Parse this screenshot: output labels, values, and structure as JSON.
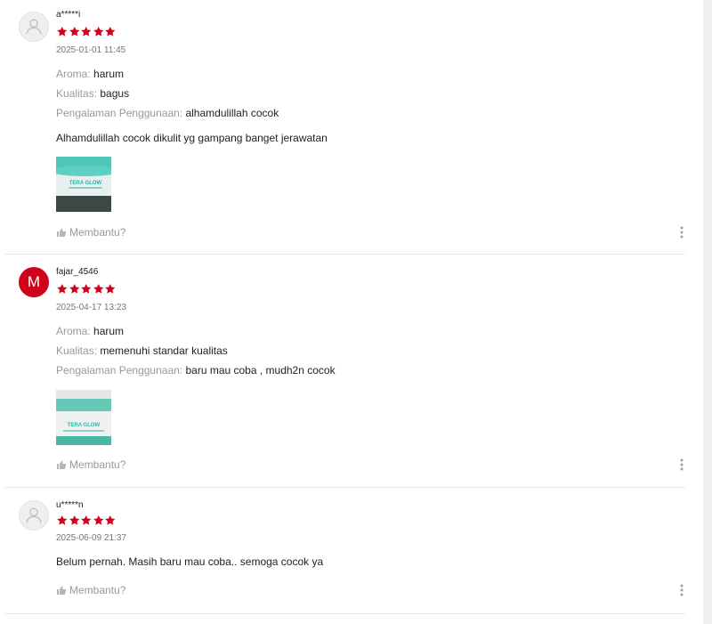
{
  "reviews": [
    {
      "username": "a*****i",
      "avatar_type": "placeholder",
      "rating": 5,
      "date": "2025-01-01 11:45",
      "attributes": [
        {
          "label": "Aroma:",
          "value": "harum"
        },
        {
          "label": "Kualitas:",
          "value": "bagus"
        },
        {
          "label": "Pengalaman Penggunaan:",
          "value": "alhamdulillah cocok"
        }
      ],
      "comment": "Alhamdulillah cocok dikulit yg gampang banget jerawatan",
      "photo_brand": "TERA GLOW",
      "helpful_label": "Membantu?"
    },
    {
      "username": "fajar_4546",
      "avatar_type": "letter",
      "avatar_letter": "M",
      "rating": 5,
      "date": "2025-04-17 13:23",
      "attributes": [
        {
          "label": "Aroma:",
          "value": "harum"
        },
        {
          "label": "Kualitas:",
          "value": "memenuhi standar kualitas"
        },
        {
          "label": "Pengalaman Penggunaan:",
          "value": "baru mau coba , mudh2n cocok"
        }
      ],
      "photo_brand": "TERA GLOW",
      "helpful_label": "Membantu?"
    },
    {
      "username": "u*****n",
      "avatar_type": "placeholder",
      "rating": 5,
      "date": "2025-06-09 21:37",
      "comment": "Belum pernah. Masih baru mau coba.. semoga cocok ya",
      "helpful_label": "Membantu?"
    }
  ],
  "colors": {
    "star": "#d0011b",
    "avatar_letter_bg": "#d0011b",
    "label": "#999999",
    "divider": "#e8e8e8"
  },
  "icons": [
    "user-placeholder-icon",
    "star-icon",
    "thumbs-up-icon",
    "kebab-menu-icon"
  ]
}
